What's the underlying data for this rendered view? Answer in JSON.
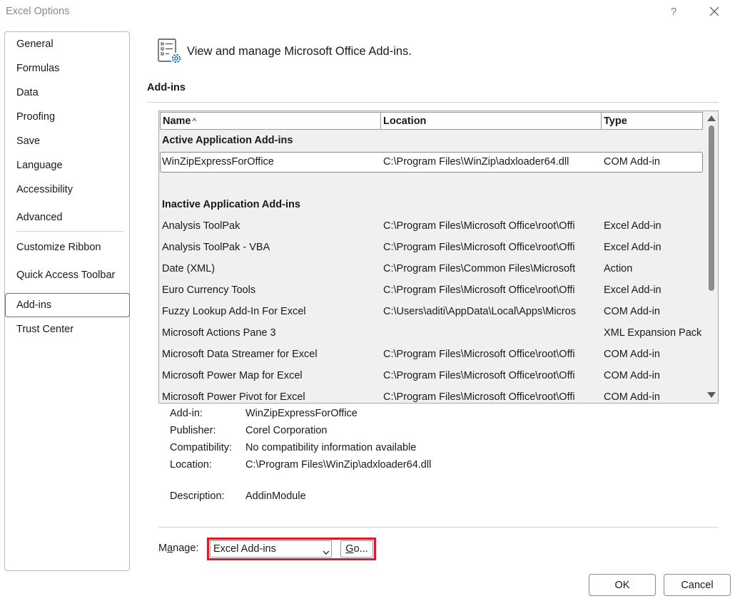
{
  "window": {
    "title": "Excel Options",
    "help_label": "?"
  },
  "sidebar": {
    "items": [
      {
        "label": "General"
      },
      {
        "label": "Formulas"
      },
      {
        "label": "Data"
      },
      {
        "label": "Proofing"
      },
      {
        "label": "Save"
      },
      {
        "label": "Language"
      },
      {
        "label": "Accessibility"
      },
      {
        "label": "Advanced"
      },
      {
        "label": "Customize Ribbon"
      },
      {
        "label": "Quick Access Toolbar"
      },
      {
        "label": "Add-ins"
      },
      {
        "label": "Trust Center"
      }
    ],
    "selected": "Add-ins"
  },
  "header": {
    "text": "View and manage Microsoft Office Add-ins."
  },
  "section": {
    "title": "Add-ins"
  },
  "table": {
    "columns": [
      {
        "label": "Name",
        "sort": "^"
      },
      {
        "label": "Location"
      },
      {
        "label": "Type"
      }
    ],
    "groups": [
      {
        "title": "Active Application Add-ins",
        "rows": [
          {
            "name": "WinZipExpressForOffice",
            "location": "C:\\Program Files\\WinZip\\adxloader64.dll",
            "type": "COM Add-in"
          }
        ]
      },
      {
        "title": "Inactive Application Add-ins",
        "rows": [
          {
            "name": "Analysis ToolPak",
            "location": "C:\\Program Files\\Microsoft Office\\root\\Offi",
            "type": "Excel Add-in"
          },
          {
            "name": "Analysis ToolPak - VBA",
            "location": "C:\\Program Files\\Microsoft Office\\root\\Offi",
            "type": "Excel Add-in"
          },
          {
            "name": "Date (XML)",
            "location": "C:\\Program Files\\Common Files\\Microsoft",
            "type": "Action"
          },
          {
            "name": "Euro Currency Tools",
            "location": "C:\\Program Files\\Microsoft Office\\root\\Offi",
            "type": "Excel Add-in"
          },
          {
            "name": "Fuzzy Lookup Add-In For Excel",
            "location": "C:\\Users\\aditi\\AppData\\Local\\Apps\\Micros",
            "type": "COM Add-in"
          },
          {
            "name": "Microsoft Actions Pane 3",
            "location": "",
            "type": "XML Expansion Pack"
          },
          {
            "name": "Microsoft Data Streamer for Excel",
            "location": "C:\\Program Files\\Microsoft Office\\root\\Offi",
            "type": "COM Add-in"
          },
          {
            "name": "Microsoft Power Map for Excel",
            "location": "C:\\Program Files\\Microsoft Office\\root\\Offi",
            "type": "COM Add-in"
          },
          {
            "name": "Microsoft Power Pivot for Excel",
            "location": "C:\\Program Files\\Microsoft Office\\root\\Offi",
            "type": "COM Add-in"
          }
        ]
      }
    ]
  },
  "details": {
    "addin_label": "Add-in:",
    "addin_value": "WinZipExpressForOffice",
    "publisher_label": "Publisher:",
    "publisher_value": "Corel Corporation",
    "compat_label": "Compatibility:",
    "compat_value": "No compatibility information available",
    "location_label": "Location:",
    "location_value": "C:\\Program Files\\WinZip\\adxloader64.dll",
    "description_label": "Description:",
    "description_value": "AddinModule"
  },
  "manage": {
    "label_pre": "M",
    "label_access": "a",
    "label_post": "nage:",
    "selected": "Excel Add-ins",
    "go_access": "G",
    "go_rest": "o..."
  },
  "buttons": {
    "ok": "OK",
    "cancel": "Cancel"
  },
  "colors": {
    "highlight": "#e0182c",
    "accent": "#0f6cbd"
  }
}
